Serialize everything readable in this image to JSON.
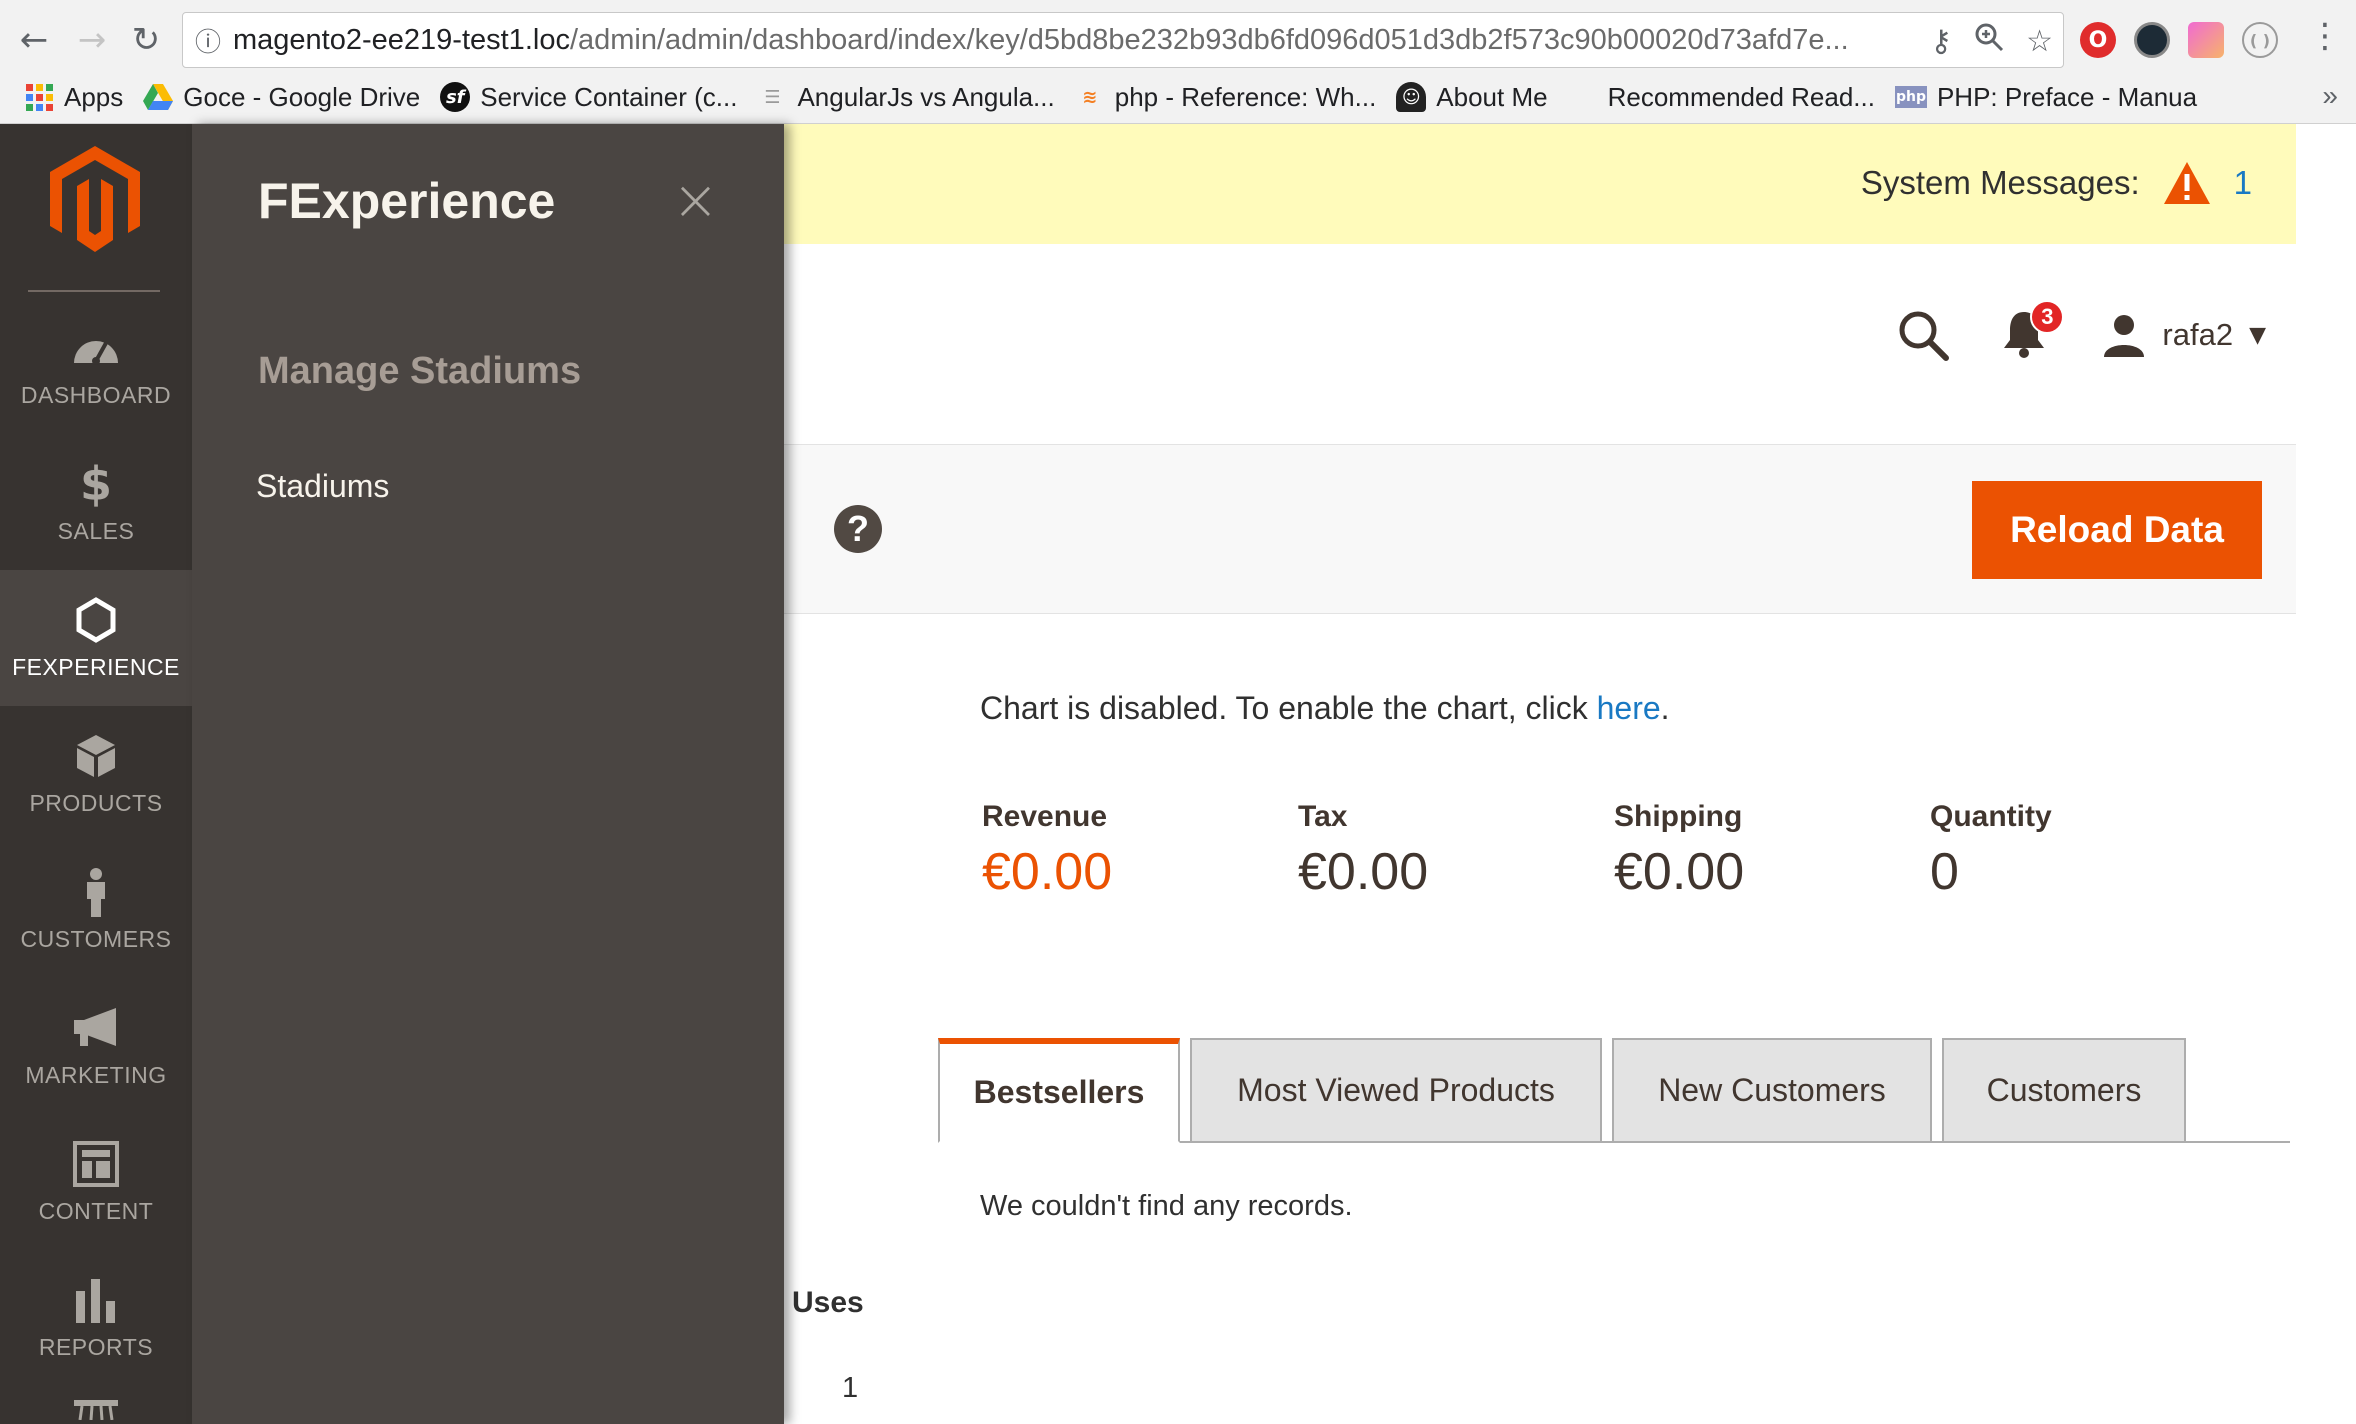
{
  "browser": {
    "url_host": "magento2-ee219-test1.loc",
    "url_path": "/admin/admin/dashboard/index/key/d5bd8be232b93db6fd096d051d3db2f573c90b00020d73afd7e...",
    "bookmarks": [
      {
        "label": "Apps",
        "icon": "apps-grid-icon"
      },
      {
        "label": "Goce - Google Drive",
        "icon": "google-drive-icon"
      },
      {
        "label": "Service Container (c...",
        "icon": "symfony-icon"
      },
      {
        "label": "AngularJs vs Angula...",
        "icon": "document-icon"
      },
      {
        "label": "php - Reference: Wh...",
        "icon": "stackoverflow-icon"
      },
      {
        "label": "About Me",
        "icon": "avatar-icon"
      },
      {
        "label": "Recommended Read...",
        "icon": "blank-icon"
      },
      {
        "label": "PHP: Preface - Manua",
        "icon": "php-icon"
      }
    ],
    "overflow": "»"
  },
  "menu": {
    "items": [
      {
        "label": "DASHBOARD",
        "icon": "dashboard-icon"
      },
      {
        "label": "SALES",
        "icon": "dollar-icon"
      },
      {
        "label": "FEXPERIENCE",
        "icon": "hexagon-icon",
        "active": true
      },
      {
        "label": "PRODUCTS",
        "icon": "cube-icon"
      },
      {
        "label": "CUSTOMERS",
        "icon": "person-icon"
      },
      {
        "label": "MARKETING",
        "icon": "megaphone-icon"
      },
      {
        "label": "CONTENT",
        "icon": "layout-icon"
      },
      {
        "label": "REPORTS",
        "icon": "bar-chart-icon"
      }
    ]
  },
  "flyout": {
    "title": "FExperience",
    "close": "×",
    "section": "Manage Stadiums",
    "link": "Stadiums"
  },
  "system_messages": {
    "label": "System Messages:",
    "count": "1"
  },
  "header": {
    "notifications_count": "3",
    "username": "rafa2"
  },
  "page_actions": {
    "help": "?",
    "reload_label": "Reload Data"
  },
  "dashboard": {
    "chart_note": "Chart is disabled. To enable the chart, click ",
    "chart_link": "here",
    "chart_note_end": ".",
    "totals": [
      {
        "label": "Revenue",
        "value": "€0.00"
      },
      {
        "label": "Tax",
        "value": "€0.00"
      },
      {
        "label": "Shipping",
        "value": "€0.00"
      },
      {
        "label": "Quantity",
        "value": "0"
      }
    ],
    "tabs": [
      "Bestsellers",
      "Most Viewed Products",
      "New Customers",
      "Customers"
    ],
    "empty_message": "We couldn't find any records.",
    "uses_header": "Uses",
    "uses_value": "1"
  },
  "colors": {
    "accent": "#eb5202",
    "menu_bg": "#373330",
    "flyout_bg": "#4a4542",
    "system_bar": "#fffbbb",
    "link": "#1979c3"
  }
}
